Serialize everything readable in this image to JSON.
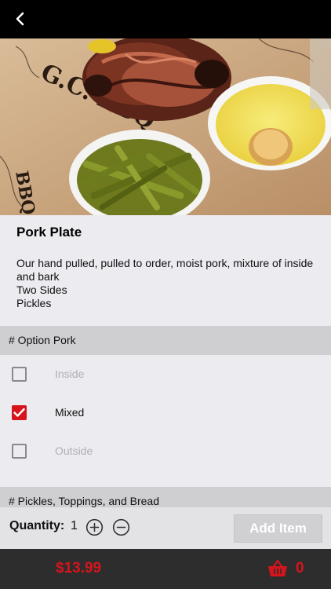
{
  "colors": {
    "accent": "#d6141c",
    "topbar": "#000000",
    "bottom_bar": "#2d2d2d",
    "section_header": "#cfcfd2"
  },
  "header": {
    "back_icon": "chevron-left-icon"
  },
  "item": {
    "title": "Pork Plate",
    "description_lines": [
      "Our hand pulled, pulled to order, moist pork, mixture of inside and bark",
      "Two Sides",
      "Pickles"
    ]
  },
  "option_sections": [
    {
      "title": "# Option Pork",
      "options": [
        {
          "label": "Inside",
          "checked": false
        },
        {
          "label": "Mixed",
          "checked": true
        },
        {
          "label": "Outside",
          "checked": false
        }
      ]
    },
    {
      "title": "# Pickles, Toppings, and Bread"
    }
  ],
  "quantity": {
    "label": "Quantity:",
    "value": "1",
    "plus_icon": "plus-circle-icon",
    "minus_icon": "minus-circle-icon"
  },
  "add_item_label": "Add Item",
  "footer": {
    "price": "$13.99",
    "cart_icon": "basket-icon",
    "cart_count": "0"
  }
}
